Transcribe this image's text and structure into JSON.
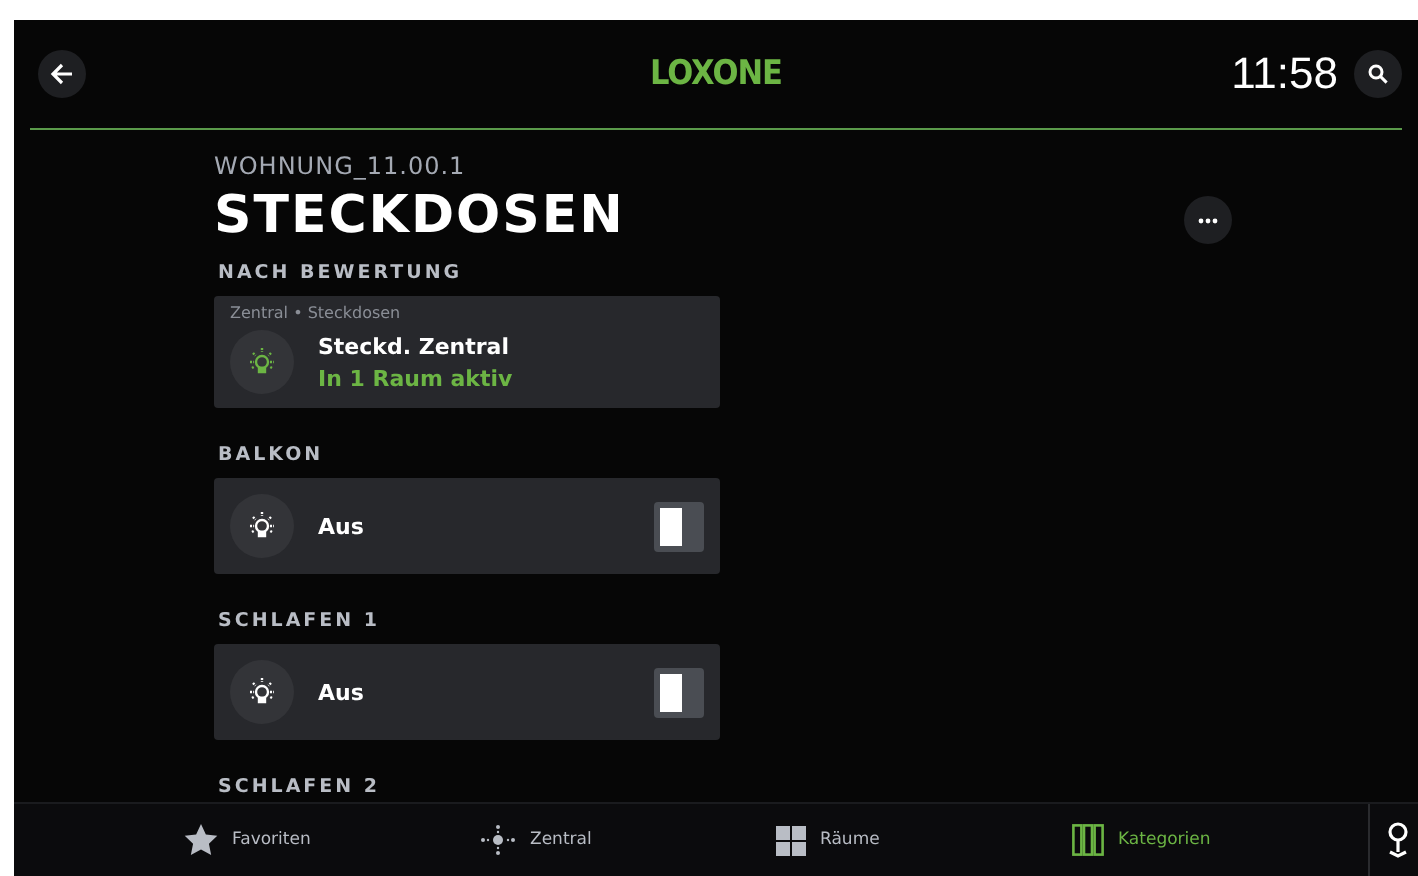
{
  "header": {
    "logo": "LOXONE",
    "time": "11:58"
  },
  "page": {
    "breadcrumb": "WOHNUNG_11.00.1",
    "title": "STECKDOSEN"
  },
  "sections": [
    {
      "heading": "NACH BEWERTUNG",
      "card": {
        "kind": "summary",
        "path": "Zentral • Steckdosen",
        "name": "Steckd. Zentral",
        "status": "In 1 Raum aktiv"
      }
    },
    {
      "heading": "BALKON",
      "card": {
        "kind": "switch",
        "name": "Aus",
        "on": false
      }
    },
    {
      "heading": "SCHLAFEN 1",
      "card": {
        "kind": "switch",
        "name": "Aus",
        "on": false
      }
    },
    {
      "heading": "SCHLAFEN 2"
    }
  ],
  "tabs": [
    {
      "label": "Favoriten",
      "kind": "star",
      "selected": false
    },
    {
      "label": "Zentral",
      "kind": "central",
      "selected": false
    },
    {
      "label": "Räume",
      "kind": "grid",
      "selected": false
    },
    {
      "label": "Kategorien",
      "kind": "columns",
      "selected": true
    }
  ]
}
